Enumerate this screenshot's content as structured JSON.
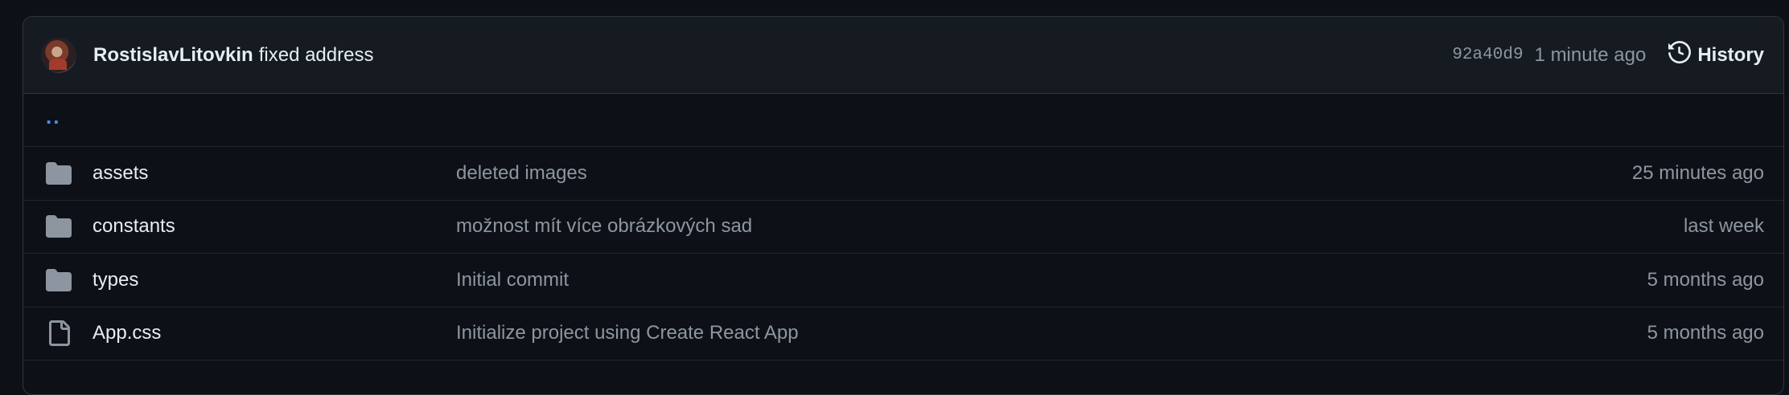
{
  "commit": {
    "author": "RostislavLitovkin",
    "message": "fixed address",
    "sha": "92a40d9",
    "time": "1 minute ago",
    "history_label": "History"
  },
  "parent_link": "..",
  "files": [
    {
      "name": "assets",
      "type": "folder",
      "message": "deleted images",
      "age": "25 minutes ago"
    },
    {
      "name": "constants",
      "type": "folder",
      "message": "možnost mít více obrázkových sad",
      "age": "last week"
    },
    {
      "name": "types",
      "type": "folder",
      "message": "Initial commit",
      "age": "5 months ago"
    },
    {
      "name": "App.css",
      "type": "file",
      "message": "Initialize project using Create React App",
      "age": "5 months ago"
    }
  ],
  "colors": {
    "background": "#0d1117",
    "header": "#161b22",
    "border": "#30363d",
    "link": "#4493f8",
    "muted": "#8d96a0",
    "icon": "#8d96a0"
  },
  "icons": {
    "folder": "folder-icon",
    "file": "file-icon",
    "history": "history-icon"
  }
}
